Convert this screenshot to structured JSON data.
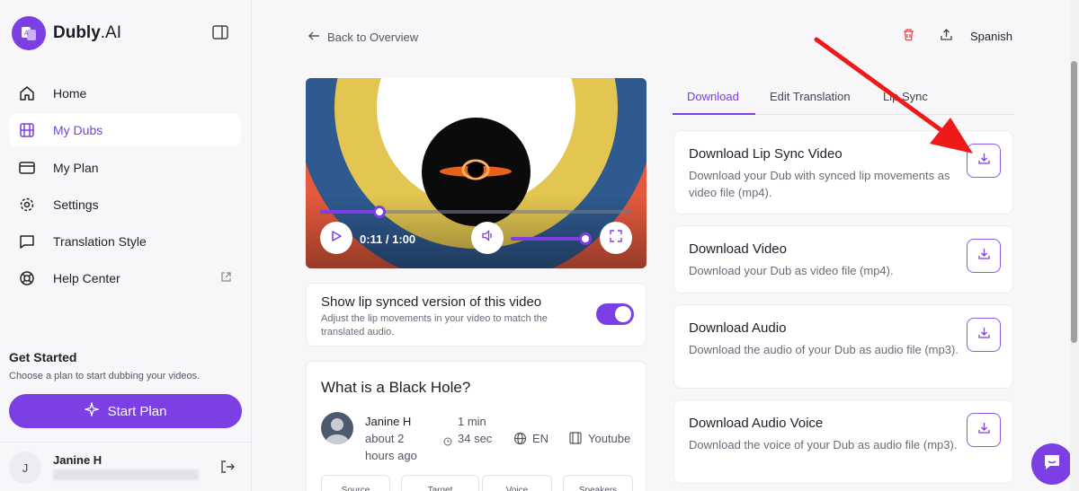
{
  "brand": {
    "name": "Dubly",
    "suffix": ".AI"
  },
  "nav": [
    {
      "label": "Home",
      "icon": "home-icon"
    },
    {
      "label": "My Dubs",
      "icon": "film-icon",
      "active": true
    },
    {
      "label": "My Plan",
      "icon": "credit-card-icon"
    },
    {
      "label": "Settings",
      "icon": "gear-icon"
    },
    {
      "label": "Translation Style",
      "icon": "chat-icon"
    },
    {
      "label": "Help Center",
      "icon": "lifebuoy-icon",
      "external": true
    }
  ],
  "get_started": {
    "title": "Get Started",
    "subtitle": "Choose a plan to start dubbing your videos.",
    "button": "Start Plan"
  },
  "user": {
    "initial": "J",
    "name": "Janine H"
  },
  "header": {
    "back": "Back to Overview",
    "language": "Spanish"
  },
  "player": {
    "time": "0:11 / 1:00",
    "progress": 0.19,
    "volume": 1.0
  },
  "lip_sync": {
    "title": "Show lip synced version of this video",
    "description": "Adjust the lip movements in your video to match the translated audio.",
    "enabled": true
  },
  "info": {
    "title": "What is a Black Hole?",
    "author": "Janine H",
    "created": "about 2 hours ago",
    "duration": "1 min 34 sec",
    "language": "EN",
    "source": "Youtube",
    "columns": [
      "Source",
      "Target",
      "Voice",
      "Speakers"
    ]
  },
  "tabs": [
    {
      "label": "Download",
      "active": true
    },
    {
      "label": "Edit Translation"
    },
    {
      "label": "Lip Sync"
    }
  ],
  "downloads": [
    {
      "title": "Download Lip Sync Video",
      "description": "Download your Dub with synced lip movements as video file (mp4)."
    },
    {
      "title": "Download Video",
      "description": "Download your Dub as video file (mp4)."
    },
    {
      "title": "Download Audio",
      "description": "Download the audio of your Dub as audio file (mp3)."
    },
    {
      "title": "Download Audio Voice",
      "description": "Download the voice of your Dub as audio file (mp3)."
    }
  ],
  "colors": {
    "accent": "#7b3fe4",
    "arrow": "#ee1a1a",
    "danger": "#e5484d"
  }
}
